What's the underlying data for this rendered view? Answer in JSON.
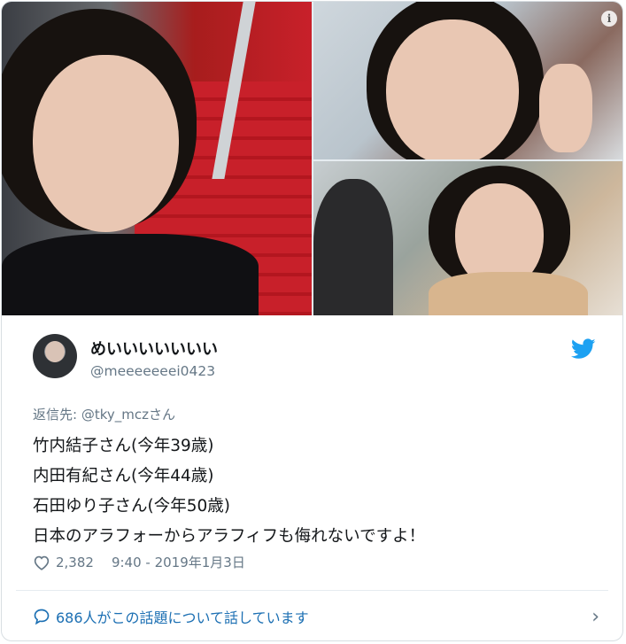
{
  "media": {
    "info_icon": "info-icon"
  },
  "user": {
    "display_name": "めいいいいいいい",
    "handle": "@meeeeeeei0423"
  },
  "reply": {
    "prefix": "返信先: ",
    "mention": "@tky_mcz",
    "suffix": "さん"
  },
  "tweet": {
    "lines": [
      "竹内結子さん(今年39歳)",
      "内田有紀さん(今年44歳)",
      "石田ゆり子さん(今年50歳)",
      "日本のアラフォーからアラフィフも侮れないですよ！"
    ]
  },
  "meta": {
    "likes": "2,382",
    "timestamp": "9:40 - 2019年1月3日"
  },
  "footer": {
    "text": "686人がこの話題について話しています"
  },
  "colors": {
    "twitter_blue": "#1da1f2",
    "link_blue": "#1b6fb3",
    "secondary_text": "#657786"
  }
}
